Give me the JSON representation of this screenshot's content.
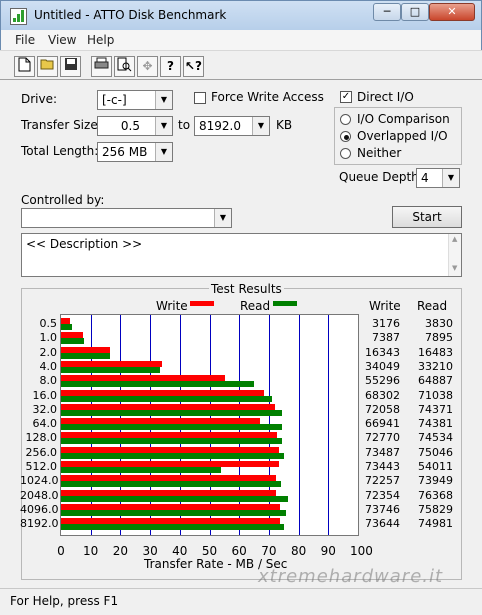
{
  "window": {
    "title": "Untitled - ATTO Disk Benchmark",
    "min": "─",
    "max": "□",
    "close": "✕"
  },
  "menu": [
    "File",
    "View",
    "Help"
  ],
  "toolbar_icons": [
    "new-document-icon",
    "open-folder-icon",
    "save-icon",
    "print-icon",
    "print-preview-icon",
    "move-icon",
    "help-icon",
    "context-help-icon"
  ],
  "settings": {
    "drive_label": "Drive:",
    "drive_value": "[-c-]",
    "force_write_label": "Force Write Access",
    "direct_io_label": "Direct I/O",
    "transfer_label": "Transfer Size:",
    "transfer_from": "0.5",
    "to_label": "to",
    "transfer_to": "8192.0",
    "kb_label": "KB",
    "total_label": "Total Length:",
    "total_value": "256 MB",
    "io_compare_label": "I/O Comparison",
    "overlapped_label": "Overlapped I/O",
    "neither_label": "Neither",
    "queue_label": "Queue Depth:",
    "queue_value": "4",
    "controlled_label": "Controlled by:",
    "controlled_value": "",
    "start_label": "Start",
    "description": "<< Description >>"
  },
  "results": {
    "group_title": "Test Results",
    "legend_write": "Write",
    "legend_read": "Read",
    "col_write": "Write",
    "col_read": "Read",
    "write_color": "#ff0000",
    "read_color": "#008000",
    "grid_color": "#0000c0"
  },
  "chart_data": {
    "type": "bar",
    "categories": [
      "0.5",
      "1.0",
      "2.0",
      "4.0",
      "8.0",
      "16.0",
      "32.0",
      "64.0",
      "128.0",
      "256.0",
      "512.0",
      "1024.0",
      "2048.0",
      "4096.0",
      "8192.0"
    ],
    "series": [
      {
        "name": "Write",
        "values": [
          3176,
          7387,
          16343,
          34049,
          55296,
          68302,
          72058,
          66941,
          72770,
          73487,
          73443,
          72257,
          72354,
          73746,
          73644
        ]
      },
      {
        "name": "Read",
        "values": [
          3830,
          7895,
          16483,
          33210,
          64887,
          71038,
          74371,
          74381,
          74534,
          75046,
          54011,
          73949,
          76368,
          75829,
          74981
        ]
      }
    ],
    "xlabel": "Transfer Rate - MB / Sec",
    "xticks": [
      "0",
      "10",
      "20",
      "30",
      "40",
      "50",
      "60",
      "70",
      "80",
      "90",
      "100"
    ],
    "xlim": [
      0,
      100
    ]
  },
  "status": {
    "text": "For Help, press F1"
  },
  "watermark": "xtremehardware.it"
}
